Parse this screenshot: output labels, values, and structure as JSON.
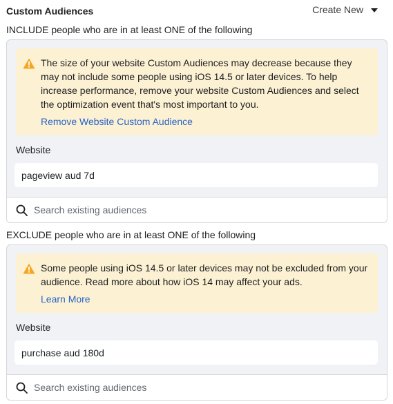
{
  "header": {
    "title": "Custom Audiences",
    "create_new_label": "Create New"
  },
  "include": {
    "label": "INCLUDE people who are in at least ONE of the following",
    "warning_text": "The size of your website Custom Audiences may decrease because they may not include some people using iOS 14.5 or later devices. To help increase performance, remove your website Custom Audiences and select the optimization event that's most important to you.",
    "warning_link": "Remove Website Custom Audience",
    "field_label": "Website",
    "audience": "pageview aud 7d",
    "search_placeholder": "Search existing audiences"
  },
  "exclude": {
    "label": "EXCLUDE people who are in at least ONE of the following",
    "warning_text": "Some people using iOS 14.5 or later devices may not be excluded from your audience. Read more about how iOS 14 may affect your ads.",
    "warning_link": "Learn More",
    "field_label": "Website",
    "audience": "purchase aud 180d",
    "search_placeholder": "Search existing audiences"
  },
  "colors": {
    "warning_bg": "#fdf1d3",
    "warning_icon": "#f5a623",
    "link": "#2563c9",
    "panel_bg": "#f0f2f5"
  }
}
